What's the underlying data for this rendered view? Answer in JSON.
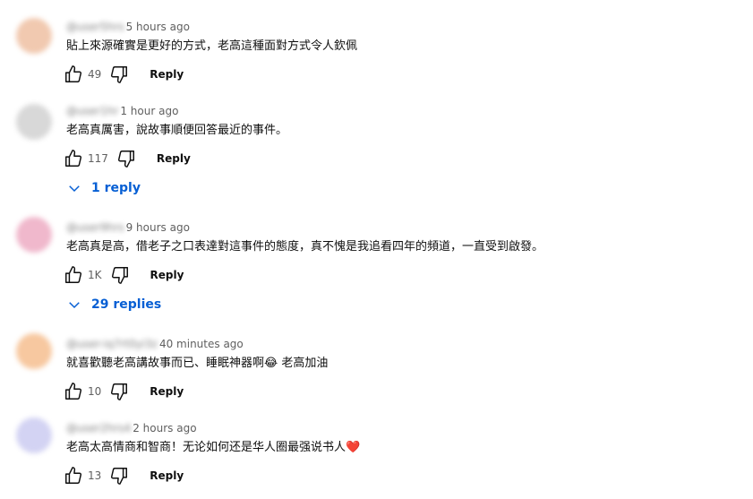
{
  "comments": [
    {
      "author": "@user5hrs",
      "time": "5 hours ago",
      "text": "貼上來源確實是更好的方式，老高這種面對方式令人欽佩",
      "likes": "49",
      "reply_label": "Reply",
      "avatar_color": "#f1c9b0"
    },
    {
      "author": "@user1hr",
      "time": "1 hour ago",
      "text": "老高真厲害，說故事順便回答最近的事件。",
      "likes": "117",
      "reply_label": "Reply",
      "replies_label": "1 reply",
      "avatar_color": "#d8d8d8"
    },
    {
      "author": "@user9hrs",
      "time": "9 hours ago",
      "text": "老高真是高，借老子之口表達對這事件的態度，真不愧是我追看四年的頻道，一直受到啟發。",
      "likes": "1K",
      "reply_label": "Reply",
      "replies_label": "29 replies",
      "avatar_color": "#f0b8cc"
    },
    {
      "author": "@user-iq7rt0yi3z",
      "time": "40 minutes ago",
      "text": "就喜歡聽老高講故事而已、睡眠神器啊😂 老高加油",
      "likes": "10",
      "reply_label": "Reply",
      "avatar_color": "#f7c8a0"
    },
    {
      "author": "@user2hrs4",
      "time": "2 hours ago",
      "text": "老高太高情商和智商！无论如何还是华人圈最强说书人❤️",
      "likes": "13",
      "reply_label": "Reply",
      "avatar_color": "#d3d3f3"
    }
  ]
}
